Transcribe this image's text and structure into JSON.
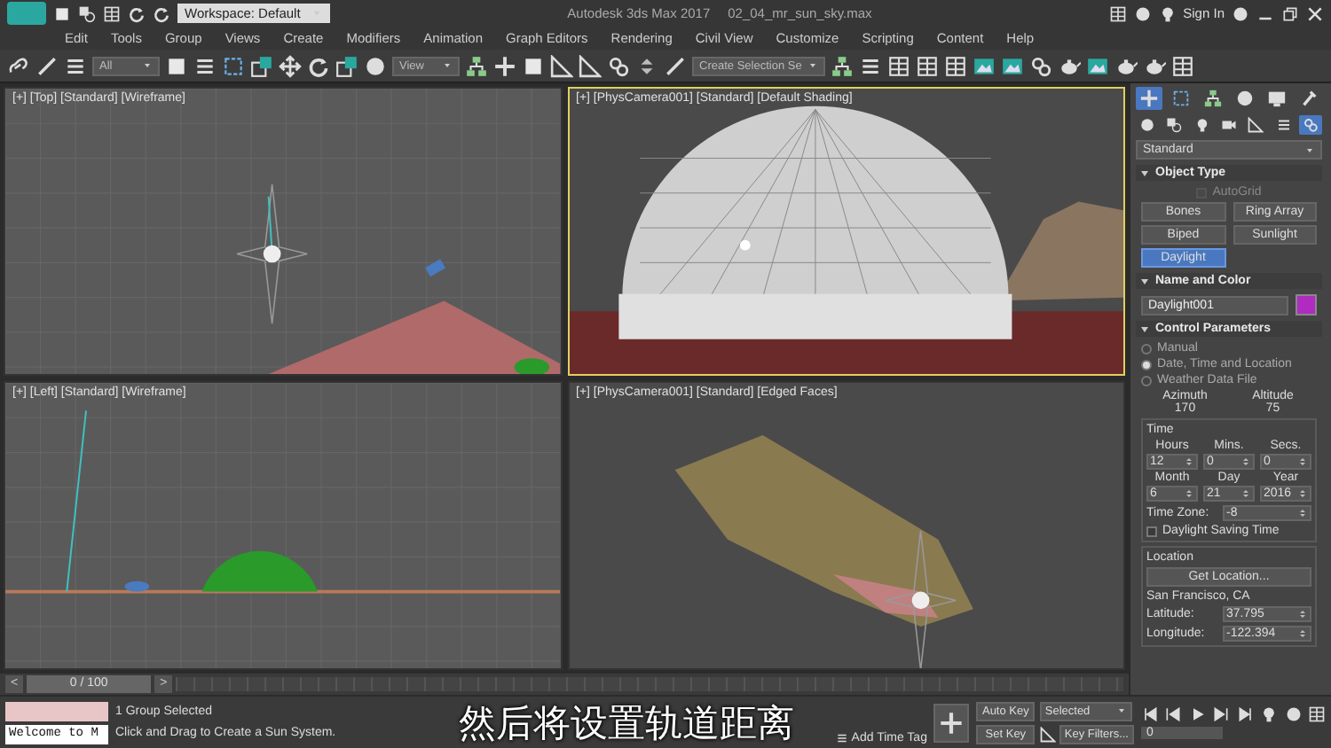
{
  "title_bar": {
    "workspace": "Workspace: Default",
    "app_title": "Autodesk 3ds Max 2017",
    "file_name": "02_04_mr_sun_sky.max",
    "sign_in": "Sign In"
  },
  "menu": [
    "Edit",
    "Tools",
    "Group",
    "Views",
    "Create",
    "Modifiers",
    "Animation",
    "Graph Editors",
    "Rendering",
    "Civil View",
    "Customize",
    "Scripting",
    "Content",
    "Help"
  ],
  "toolbar": {
    "selection_filter": "All",
    "coordinate_system": "View",
    "selection_set": "Create Selection Se"
  },
  "viewports": [
    {
      "kind": "top",
      "label": "[+] [Top] [Standard] [Wireframe]",
      "selected": false
    },
    {
      "kind": "camera",
      "label": "[+] [PhysCamera001] [Standard] [Default Shading]",
      "selected": true
    },
    {
      "kind": "left",
      "label": "[+] [Left] [Standard] [Wireframe]",
      "selected": false
    },
    {
      "kind": "camera_edged",
      "label": "[+] [PhysCamera001] [Standard] [Edged Faces]",
      "selected": false
    }
  ],
  "command_panel": {
    "tabs": [
      {
        "selected": true
      },
      {
        "selected": false
      },
      {
        "selected": false
      },
      {
        "selected": false
      },
      {
        "selected": false
      },
      {
        "selected": false
      }
    ],
    "categories": [
      {
        "selected": false
      },
      {
        "selected": false
      },
      {
        "selected": false
      },
      {
        "selected": false
      },
      {
        "selected": false
      },
      {
        "selected": false
      },
      {
        "selected": true
      }
    ],
    "dropdown": "Standard",
    "object_type": {
      "title": "Object Type",
      "autogrid": {
        "label": "AutoGrid",
        "checked": false,
        "disabled": true
      },
      "buttons": [
        {
          "label": "Bones",
          "selected": false
        },
        {
          "label": "Ring Array",
          "selected": false
        },
        {
          "label": "Biped",
          "selected": false
        },
        {
          "label": "Sunlight",
          "selected": false
        },
        {
          "label": "Daylight",
          "selected": true
        }
      ]
    },
    "name_and_color": {
      "title": "Name and Color",
      "name": "Daylight001",
      "color": "#b02cc0"
    },
    "control_parameters": {
      "title": "Control Parameters",
      "modes": [
        {
          "label": "Manual",
          "selected": false
        },
        {
          "label": "Date, Time and Location",
          "selected": true
        },
        {
          "label": "Weather Data File",
          "selected": false
        }
      ],
      "azimuth": {
        "label": "Azimuth",
        "value": "170"
      },
      "altitude": {
        "label": "Altitude",
        "value": "75"
      },
      "time": {
        "title": "Time",
        "fields": [
          {
            "label": "Hours",
            "value": "12"
          },
          {
            "label": "Mins.",
            "value": "0"
          },
          {
            "label": "Secs.",
            "value": "0"
          },
          {
            "label": "Month",
            "value": "6"
          },
          {
            "label": "Day",
            "value": "21"
          },
          {
            "label": "Year",
            "value": "2016"
          }
        ],
        "time_zone": {
          "label": "Time Zone:",
          "value": "-8"
        },
        "daylight_saving": {
          "label": "Daylight Saving Time",
          "checked": false
        }
      },
      "location": {
        "title": "Location",
        "button": "Get Location...",
        "city": "San Francisco, CA",
        "latitude": {
          "label": "Latitude:",
          "value": "37.795"
        },
        "longitude": {
          "label": "Longitude:",
          "value": "-122.394"
        }
      }
    }
  },
  "timeline": {
    "position": "0 / 100",
    "prev": "<",
    "next": ">"
  },
  "status": {
    "script_output": "Welcome to M",
    "selection": "1 Group Selected",
    "prompt": "Click and Drag to Create a Sun System.",
    "add_time_tag": "Add Time Tag",
    "auto_key": "Auto Key",
    "key_mode": "Selected",
    "set_key": "Set Key",
    "key_filters": "Key Filters...",
    "frame": "0"
  },
  "subtitle": "然后将设置轨道距离"
}
